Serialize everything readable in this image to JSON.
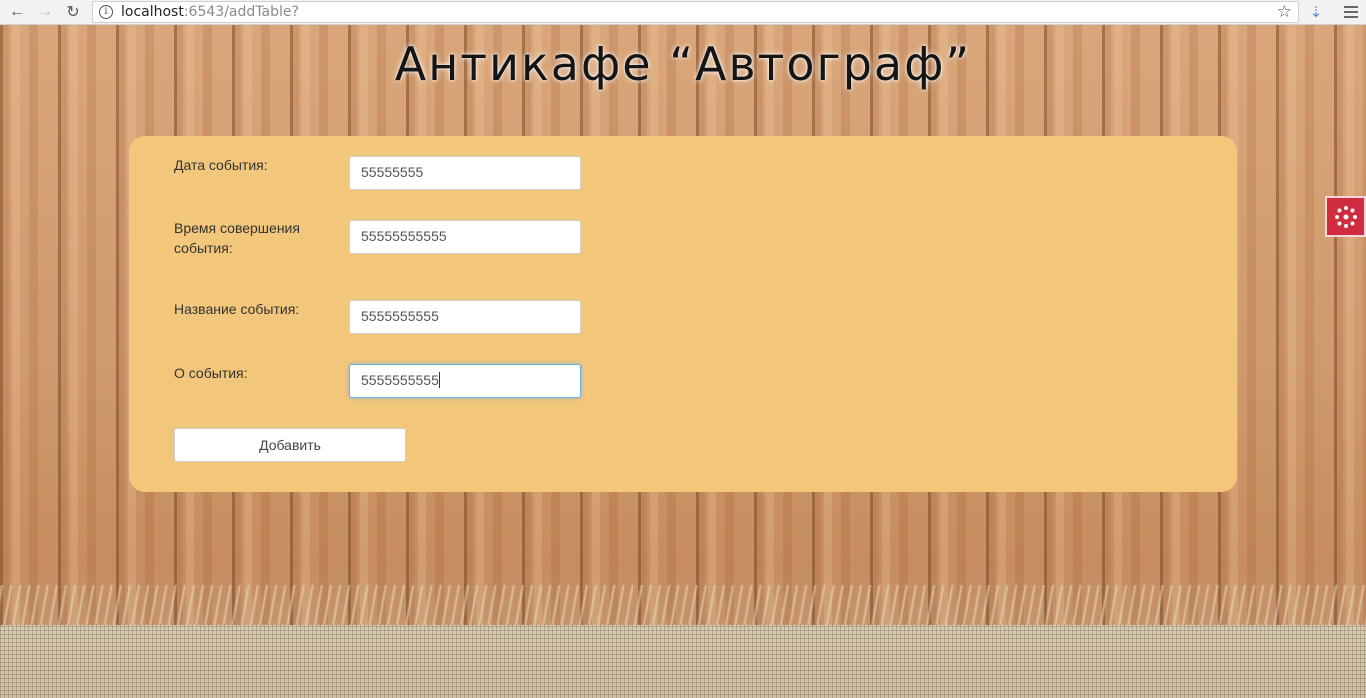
{
  "browser": {
    "url_host": "localhost",
    "url_rest": ":6543/addTable?"
  },
  "page": {
    "title": "Антикафе  “Автограф”"
  },
  "form": {
    "fields": [
      {
        "label": "Дата события:",
        "value": "55555555"
      },
      {
        "label": "Время совершения события:",
        "value": "55555555555"
      },
      {
        "label": "Название события:",
        "value": "5555555555"
      },
      {
        "label": "О события:",
        "value": "5555555555"
      }
    ],
    "submit_label": "Добавить"
  },
  "colors": {
    "panel": "#f2c67b",
    "extension": "#d12b3f"
  },
  "icons": {
    "back": "arrow-left-icon",
    "forward": "arrow-right-icon",
    "reload": "reload-icon",
    "info": "info-icon",
    "star": "star-icon",
    "download": "download-icon",
    "menu": "menu-icon",
    "extension": "dots-circle-icon"
  }
}
